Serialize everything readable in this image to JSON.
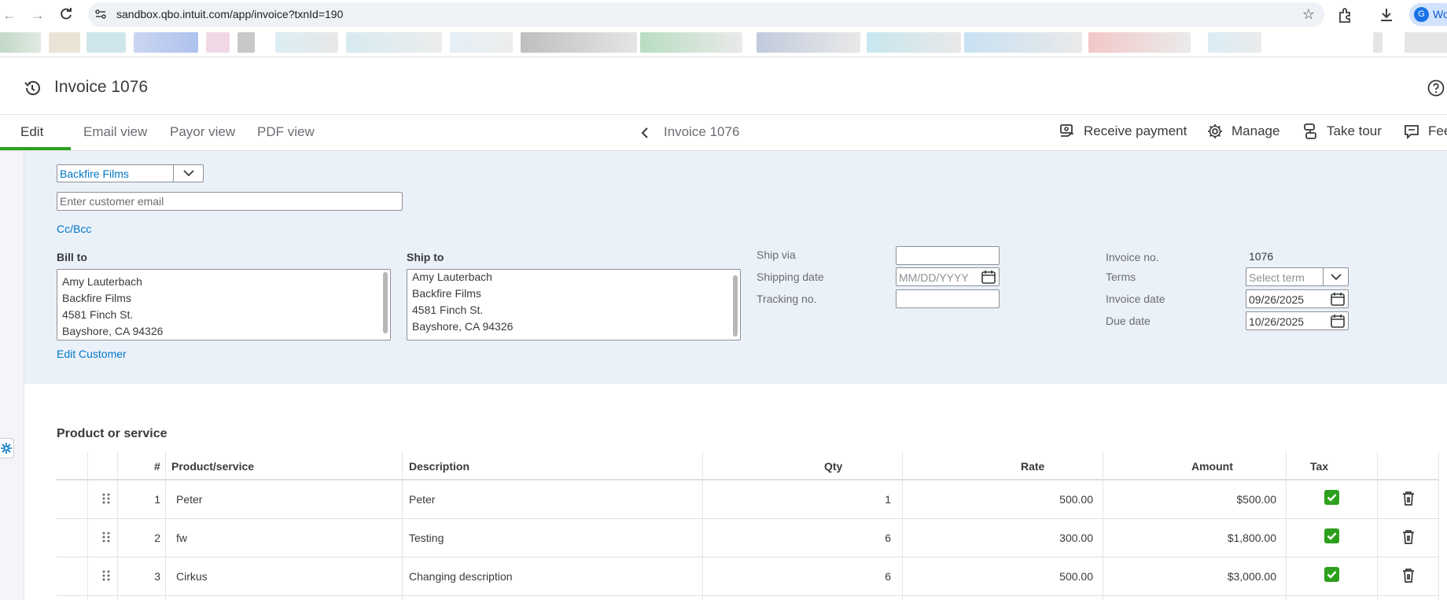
{
  "browser": {
    "url": "sandbox.qbo.intuit.com/app/invoice?txnId=190",
    "profile_initial": "G",
    "profile_label": "Wo"
  },
  "header": {
    "title": "Invoice 1076"
  },
  "tabs": [
    {
      "label": "Edit",
      "active": true
    },
    {
      "label": "Email view"
    },
    {
      "label": "Payor view"
    },
    {
      "label": "PDF view"
    }
  ],
  "center_title": "Invoice 1076",
  "actions": {
    "receive_payment": "Receive payment",
    "manage": "Manage",
    "take_tour": "Take tour",
    "feedback": "Fee"
  },
  "form": {
    "customer": "Backfire Films",
    "email_placeholder": "Enter customer email",
    "cc_bcc": "Cc/Bcc",
    "bill_to_label": "Bill to",
    "ship_to_label": "Ship to",
    "bill_to_lines": [
      "Amy Lauterbach",
      "Backfire Films",
      "4581 Finch St.",
      "Bayshore, CA  94326"
    ],
    "ship_to_lines": [
      "Amy Lauterbach",
      "Backfire Films",
      "4581 Finch St.",
      "Bayshore, CA  94326"
    ],
    "edit_customer": "Edit Customer",
    "ship_via_label": "Ship via",
    "ship_via_value": "",
    "shipping_date_label": "Shipping date",
    "shipping_date_placeholder": "MM/DD/YYYY",
    "tracking_label": "Tracking no.",
    "tracking_value": "",
    "invoice_no_label": "Invoice no.",
    "invoice_no_value": "1076",
    "terms_label": "Terms",
    "terms_placeholder": "Select term",
    "invoice_date_label": "Invoice date",
    "invoice_date_value": "09/26/2025",
    "due_date_label": "Due date",
    "due_date_value": "10/26/2025"
  },
  "products": {
    "section_title": "Product or service",
    "columns": {
      "num": "#",
      "product": "Product/service",
      "description": "Description",
      "qty": "Qty",
      "rate": "Rate",
      "amount": "Amount",
      "tax": "Tax"
    },
    "rows": [
      {
        "num": "1",
        "product": "Peter",
        "description": "Peter",
        "qty": "1",
        "rate": "500.00",
        "amount": "$500.00",
        "tax": true
      },
      {
        "num": "2",
        "product": "fw",
        "description": "Testing",
        "qty": "6",
        "rate": "300.00",
        "amount": "$1,800.00",
        "tax": true
      },
      {
        "num": "3",
        "product": "Cirkus",
        "description": "Changing description",
        "qty": "6",
        "rate": "500.00",
        "amount": "$3,000.00",
        "tax": true
      }
    ]
  },
  "colors": {
    "accent_green": "#2ca01c",
    "link_blue": "#0077c5",
    "form_bg": "#ebf1f9"
  }
}
